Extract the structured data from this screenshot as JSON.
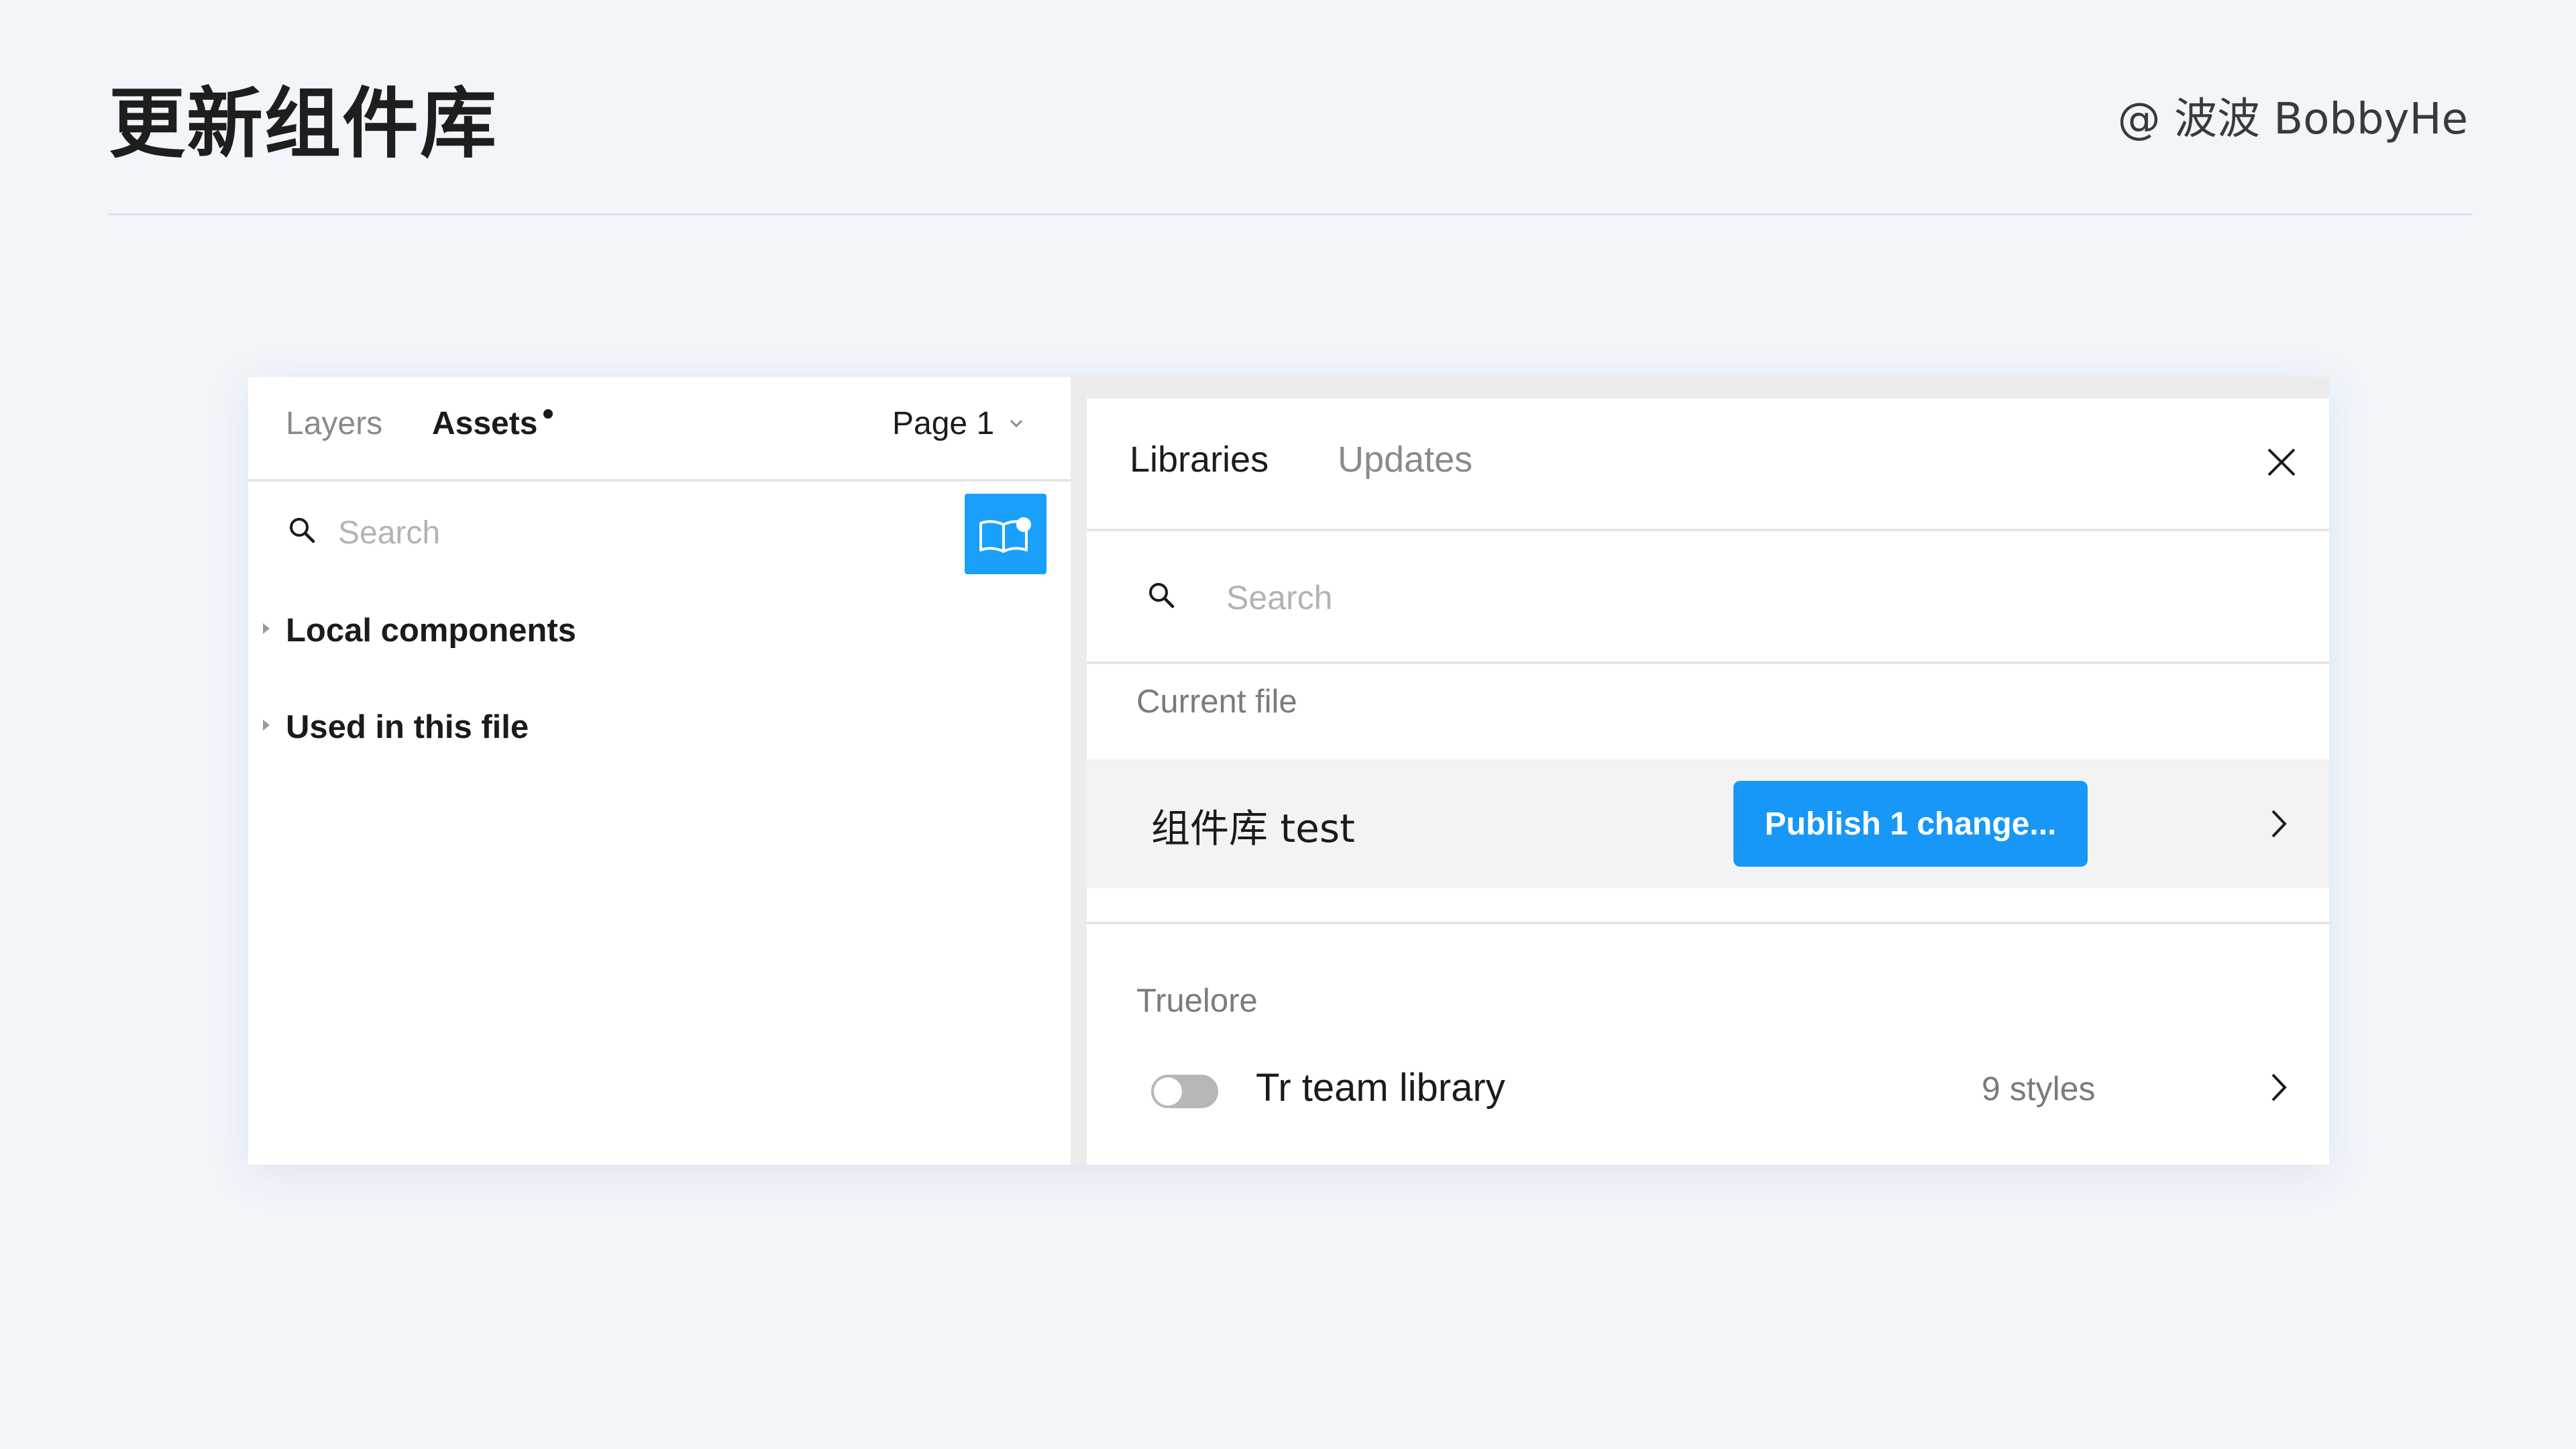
{
  "slide": {
    "title": "更新组件库",
    "author": "@ 波波 BobbyHe"
  },
  "assets_panel": {
    "tabs": [
      {
        "label": "Layers",
        "active": false
      },
      {
        "label": "Assets",
        "active": true,
        "has_indicator": true
      }
    ],
    "page_select": {
      "value": "Page 1"
    },
    "search": {
      "placeholder": "Search",
      "value": ""
    },
    "view_icon": "list-view-icon",
    "library_icon": "team-library-icon",
    "accent_color": "#18a0fb",
    "sections": [
      {
        "label": "Local components",
        "expanded": false
      },
      {
        "label": "Used in this file",
        "expanded": false
      }
    ]
  },
  "libraries_panel": {
    "tabs": [
      {
        "label": "Libraries",
        "active": true
      },
      {
        "label": "Updates",
        "active": false
      }
    ],
    "close_icon": "close-icon",
    "search": {
      "placeholder": "Search",
      "value": ""
    },
    "current_file": {
      "heading": "Current file",
      "name": "组件库 test",
      "publish_label": "Publish 1 change...",
      "publish_color": "#1797f7"
    },
    "team": {
      "heading": "Truelore",
      "libraries": [
        {
          "name": "Tr team library",
          "meta": "9 styles",
          "enabled": false
        }
      ]
    }
  }
}
